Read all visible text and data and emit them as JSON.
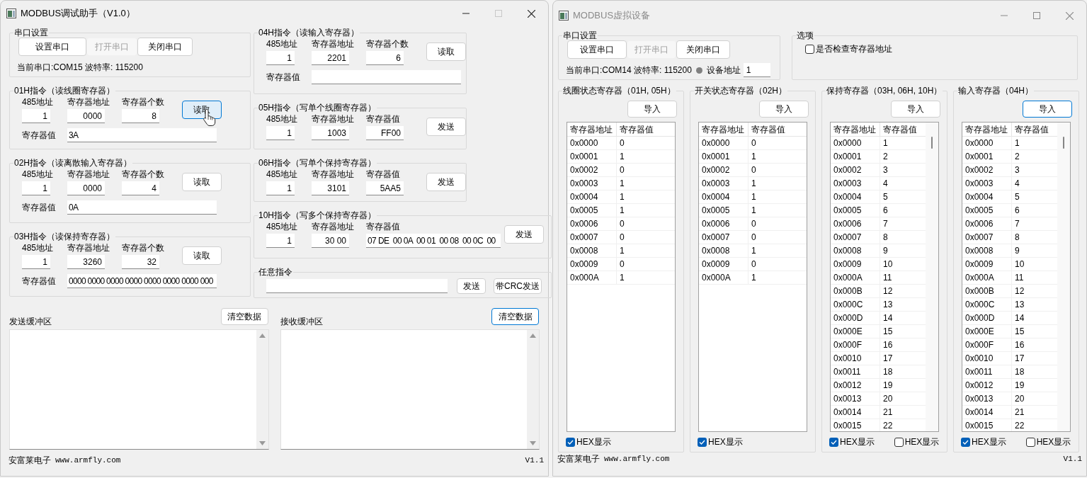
{
  "left_window": {
    "title": "MODBUS调试助手（V1.0）",
    "active": true,
    "serial": {
      "title": "串口设置",
      "buttons": [
        {
          "label": "设置串口",
          "disabled": false,
          "focused": false
        },
        {
          "label": "打开串口",
          "disabled": true,
          "focused": false
        },
        {
          "label": "关闭串口",
          "disabled": false,
          "focused": false
        }
      ],
      "status": "当前串口:COM15 波特率: 115200"
    },
    "commands_left": [
      {
        "kind": "read",
        "title": "01H指令（读线圈寄存器）",
        "fields": [
          {
            "label": "485地址",
            "value": "1"
          },
          {
            "label": "寄存器地址",
            "value": "0000"
          },
          {
            "label": "寄存器个数",
            "value": "8"
          }
        ],
        "value_label": "寄存器值",
        "value": "3A",
        "button": {
          "label": "读取",
          "hovered": true,
          "focused": true
        }
      },
      {
        "kind": "read",
        "title": "02H指令（读离散输入寄存器）",
        "fields": [
          {
            "label": "485地址",
            "value": "1"
          },
          {
            "label": "寄存器地址",
            "value": "0000"
          },
          {
            "label": "寄存器个数",
            "value": "4"
          }
        ],
        "value_label": "寄存器值",
        "value": "0A",
        "button": {
          "label": "读取",
          "hovered": false,
          "focused": false
        }
      },
      {
        "kind": "read",
        "title": "03H指令（读保持寄存器）",
        "fields": [
          {
            "label": "485地址",
            "value": "1"
          },
          {
            "label": "寄存器地址",
            "value": "3260"
          },
          {
            "label": "寄存器个数",
            "value": "32"
          }
        ],
        "value_label": "寄存器值",
        "value": "0000 0000 0000 0000 0000 0000 0000 000",
        "button": {
          "label": "读取",
          "hovered": false,
          "focused": false
        }
      }
    ],
    "commands_right": [
      {
        "kind": "read",
        "title": "04H指令（读输入寄存器）",
        "fields": [
          {
            "label": "485地址",
            "value": "1"
          },
          {
            "label": "寄存器地址",
            "value": "2201"
          },
          {
            "label": "寄存器个数",
            "value": "6"
          }
        ],
        "value_label": "寄存器值",
        "button": {
          "label": "读取",
          "hovered": false,
          "focused": false
        }
      },
      {
        "kind": "write",
        "title": "05H指令（写单个线圈寄存器）",
        "fields": [
          {
            "label": "485地址",
            "value": "1"
          },
          {
            "label": "寄存器地址",
            "value": "1003"
          },
          {
            "label": "寄存器值",
            "value": "FF00"
          }
        ],
        "button": {
          "label": "发送",
          "hovered": false,
          "focused": false
        }
      },
      {
        "kind": "write",
        "title": "06H指令（写单个保持寄存器）",
        "fields": [
          {
            "label": "485地址",
            "value": "1"
          },
          {
            "label": "寄存器地址",
            "value": "3101"
          },
          {
            "label": "寄存器值",
            "value": "5AA5"
          }
        ],
        "button": {
          "label": "发送",
          "hovered": false,
          "focused": false
        }
      },
      {
        "kind": "write_multi",
        "title": "10H指令（写多个保持寄存器）",
        "fields": [
          {
            "label": "485地址",
            "value": "1"
          },
          {
            "label": "寄存器地址",
            "value": "30 00"
          },
          {
            "label": "寄存器值",
            "value": "07 DE  00 0A  00 01  00 08  00 0C  00"
          }
        ],
        "button": {
          "label": "发送",
          "hovered": false,
          "focused": false
        }
      }
    ],
    "custom": {
      "title": "任意指令",
      "buttons": [
        {
          "label": "发送",
          "disabled": false,
          "focused": false
        },
        {
          "label": "带CRC发送",
          "disabled": false,
          "focused": false
        }
      ]
    },
    "buffers": [
      {
        "label": "发送缓冲区",
        "button": {
          "label": "清空数据",
          "focused": false
        }
      },
      {
        "label": "接收缓冲区",
        "button": {
          "label": "清空数据",
          "focused": true
        }
      }
    ],
    "footer": {
      "brand": "安富莱电子",
      "url": "www.armfly.com",
      "version": "V1.1"
    }
  },
  "right_window": {
    "title": "MODBUS虚拟设备",
    "active": false,
    "serial": {
      "title": "串口设置",
      "buttons": [
        {
          "label": "设置串口",
          "disabled": false,
          "focused": false
        },
        {
          "label": "打开串口",
          "disabled": true,
          "focused": false
        },
        {
          "label": "关闭串口",
          "disabled": false,
          "focused": false
        }
      ],
      "status": "当前串口:COM14 波特率: 115200",
      "address_label": "设备地址",
      "address": "1"
    },
    "options": {
      "title": "选项",
      "checkboxes": [
        {
          "label": "是否检查寄存器地址",
          "checked": false
        }
      ]
    },
    "panels": [
      {
        "title": "线圈状态寄存器（01H, 05H）",
        "button": {
          "label": "导入",
          "focused": false
        },
        "columns": [
          "寄存器地址",
          "寄存器值"
        ],
        "scrollable": false,
        "rows": [
          [
            "0x0000",
            "0"
          ],
          [
            "0x0001",
            "1"
          ],
          [
            "0x0002",
            "0"
          ],
          [
            "0x0003",
            "1"
          ],
          [
            "0x0004",
            "1"
          ],
          [
            "0x0005",
            "1"
          ],
          [
            "0x0006",
            "0"
          ],
          [
            "0x0007",
            "0"
          ],
          [
            "0x0008",
            "1"
          ],
          [
            "0x0009",
            "0"
          ],
          [
            "0x000A",
            "1"
          ]
        ],
        "checkboxes": [
          {
            "label": "HEX显示",
            "checked": true
          }
        ]
      },
      {
        "title": "开关状态寄存器（02H）",
        "button": {
          "label": "导入",
          "focused": false
        },
        "columns": [
          "寄存器地址",
          "寄存器值"
        ],
        "scrollable": false,
        "rows": [
          [
            "0x0000",
            "0"
          ],
          [
            "0x0001",
            "1"
          ],
          [
            "0x0002",
            "0"
          ],
          [
            "0x0003",
            "1"
          ],
          [
            "0x0004",
            "1"
          ],
          [
            "0x0005",
            "1"
          ],
          [
            "0x0006",
            "0"
          ],
          [
            "0x0007",
            "0"
          ],
          [
            "0x0008",
            "1"
          ],
          [
            "0x0009",
            "0"
          ],
          [
            "0x000A",
            "1"
          ]
        ],
        "checkboxes": [
          {
            "label": "HEX显示",
            "checked": true
          }
        ]
      },
      {
        "title": "保持寄存器（03H, 06H, 10H）",
        "button": {
          "label": "导入",
          "focused": false
        },
        "columns": [
          "寄存器地址",
          "寄存器值"
        ],
        "scrollable": true,
        "rows": [
          [
            "0x0000",
            "1"
          ],
          [
            "0x0001",
            "2"
          ],
          [
            "0x0002",
            "3"
          ],
          [
            "0x0003",
            "4"
          ],
          [
            "0x0004",
            "5"
          ],
          [
            "0x0005",
            "6"
          ],
          [
            "0x0006",
            "7"
          ],
          [
            "0x0007",
            "8"
          ],
          [
            "0x0008",
            "9"
          ],
          [
            "0x0009",
            "10"
          ],
          [
            "0x000A",
            "11"
          ],
          [
            "0x000B",
            "12"
          ],
          [
            "0x000C",
            "13"
          ],
          [
            "0x000D",
            "14"
          ],
          [
            "0x000E",
            "15"
          ],
          [
            "0x000F",
            "16"
          ],
          [
            "0x0010",
            "17"
          ],
          [
            "0x0011",
            "18"
          ],
          [
            "0x0012",
            "19"
          ],
          [
            "0x0013",
            "20"
          ],
          [
            "0x0014",
            "21"
          ],
          [
            "0x0015",
            "22"
          ]
        ],
        "checkboxes": [
          {
            "label": "HEX显示",
            "checked": true
          },
          {
            "label": "HEX显示",
            "checked": false
          }
        ]
      },
      {
        "title": "输入寄存器（04H）",
        "button": {
          "label": "导入",
          "focused": true
        },
        "columns": [
          "寄存器地址",
          "寄存器值"
        ],
        "scrollable": true,
        "rows": [
          [
            "0x0000",
            "1"
          ],
          [
            "0x0001",
            "2"
          ],
          [
            "0x0002",
            "3"
          ],
          [
            "0x0003",
            "4"
          ],
          [
            "0x0004",
            "5"
          ],
          [
            "0x0005",
            "6"
          ],
          [
            "0x0006",
            "7"
          ],
          [
            "0x0007",
            "8"
          ],
          [
            "0x0008",
            "9"
          ],
          [
            "0x0009",
            "10"
          ],
          [
            "0x000A",
            "11"
          ],
          [
            "0x000B",
            "12"
          ],
          [
            "0x000C",
            "13"
          ],
          [
            "0x000D",
            "14"
          ],
          [
            "0x000E",
            "15"
          ],
          [
            "0x000F",
            "16"
          ],
          [
            "0x0010",
            "17"
          ],
          [
            "0x0011",
            "18"
          ],
          [
            "0x0012",
            "19"
          ],
          [
            "0x0013",
            "20"
          ],
          [
            "0x0014",
            "21"
          ],
          [
            "0x0015",
            "22"
          ]
        ],
        "checkboxes": [
          {
            "label": "HEX显示",
            "checked": true
          },
          {
            "label": "HEX显示",
            "checked": false
          }
        ]
      }
    ],
    "footer": {
      "brand": "安富莱电子",
      "url": "www.armfly.com",
      "version": "V1.1"
    }
  }
}
